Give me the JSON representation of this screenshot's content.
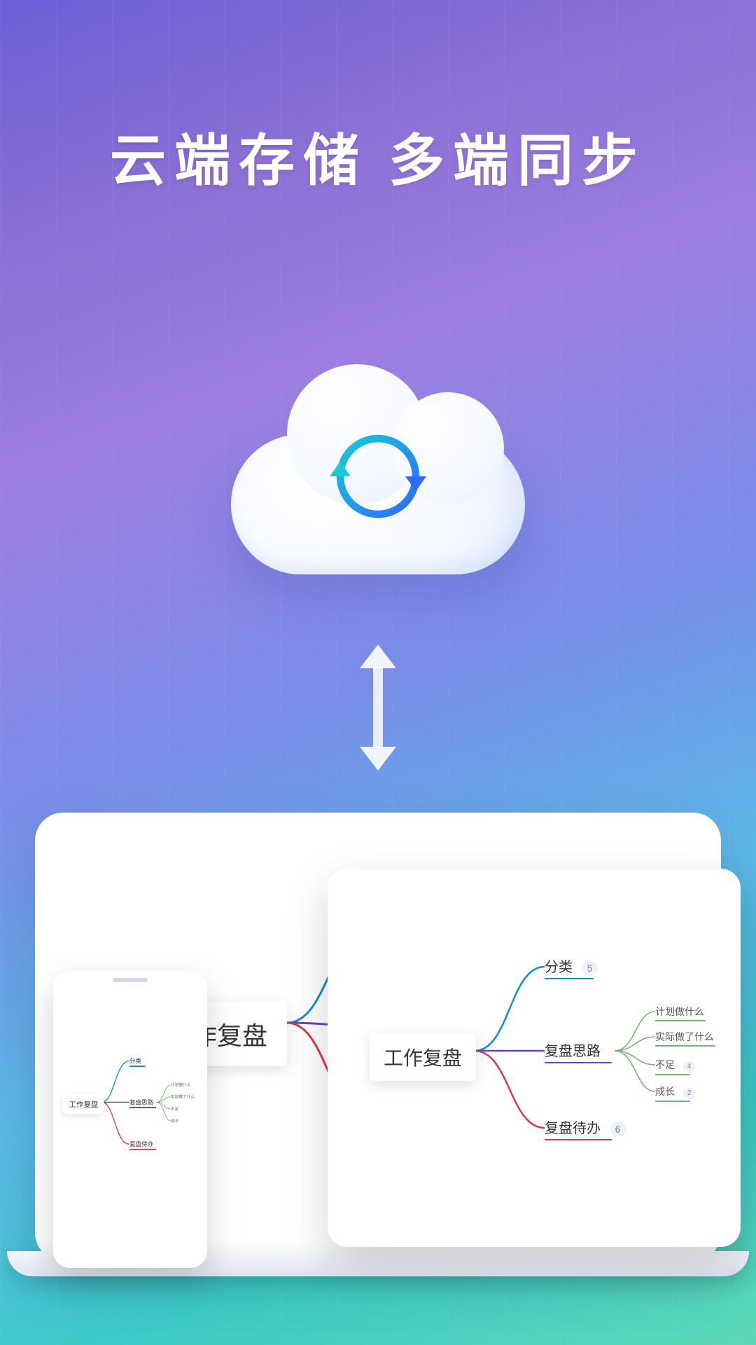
{
  "headline": {
    "part1": "云端存储",
    "part2": "多端同步"
  },
  "colors": {
    "category": "#0d8fd6",
    "thinking": "#6b3fcf",
    "todo": "#d83a4a",
    "sub": "#76b36e"
  },
  "mindmap": {
    "root": "工作复盘",
    "children": [
      {
        "label": "分类",
        "badge": "5",
        "color": "category"
      },
      {
        "label": "复盘思路",
        "color": "thinking",
        "sub": [
          {
            "label": "计划做什么"
          },
          {
            "label": "实际做了什么"
          },
          {
            "label": "不足",
            "badge": "4"
          },
          {
            "label": "成长",
            "badge": "2"
          }
        ]
      },
      {
        "label": "复盘待办",
        "badge": "6",
        "color": "todo"
      }
    ]
  }
}
